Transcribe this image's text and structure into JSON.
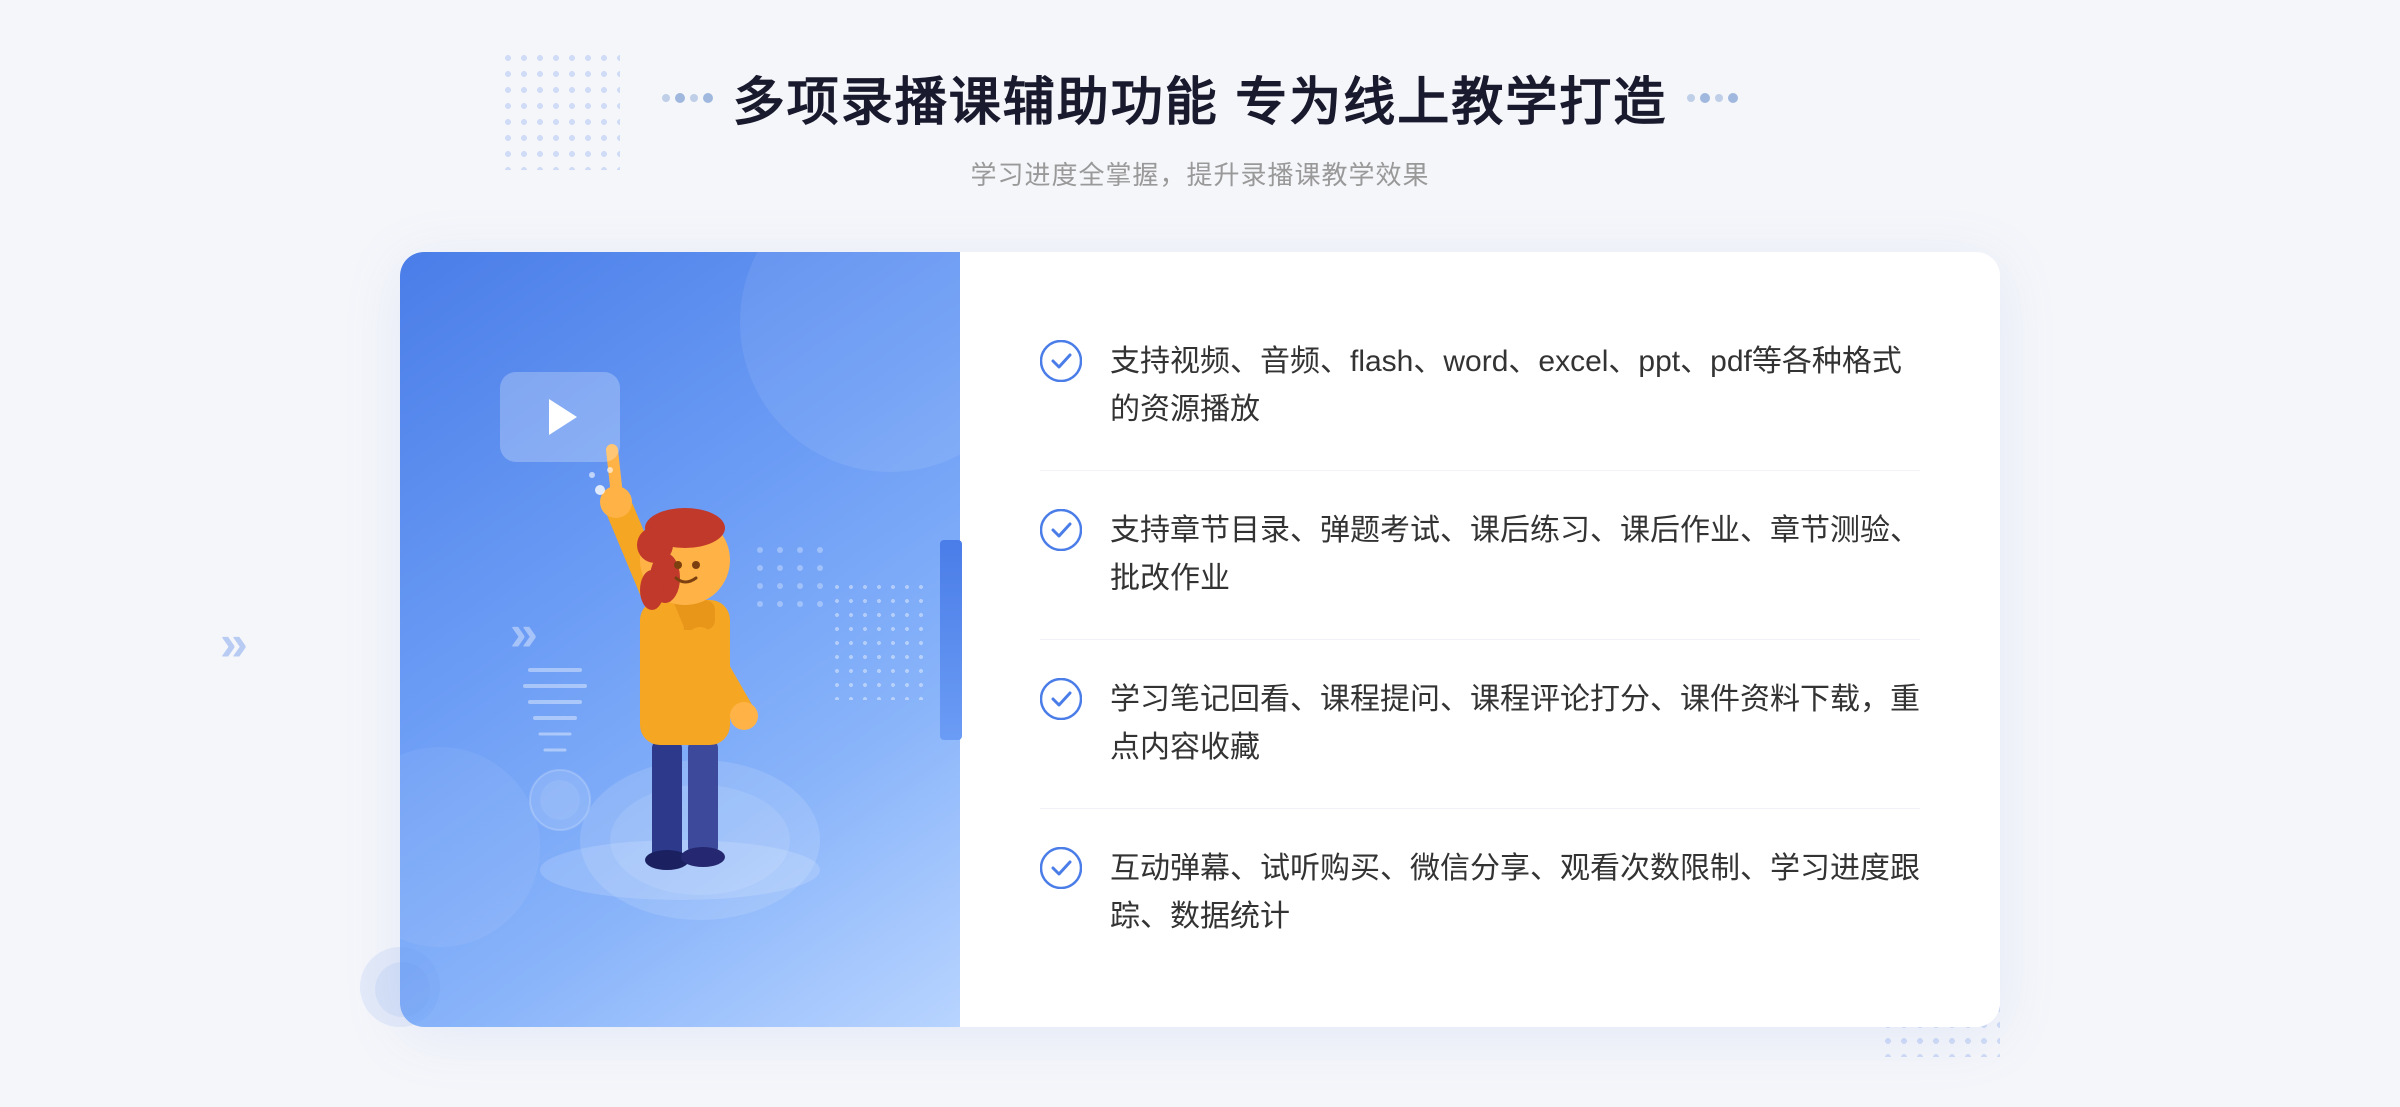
{
  "header": {
    "title": "多项录播课辅助功能 专为线上教学打造",
    "subtitle": "学习进度全掌握，提升录播课教学效果"
  },
  "features": [
    {
      "id": 1,
      "text": "支持视频、音频、flash、word、excel、ppt、pdf等各种格式的资源播放"
    },
    {
      "id": 2,
      "text": "支持章节目录、弹题考试、课后练习、课后作业、章节测验、批改作业"
    },
    {
      "id": 3,
      "text": "学习笔记回看、课程提问、课程评论打分、课件资料下载，重点内容收藏"
    },
    {
      "id": 4,
      "text": "互动弹幕、试听购买、微信分享、观看次数限制、学习进度跟踪、数据统计"
    }
  ],
  "icons": {
    "check_color": "#4a7de8",
    "title_dot_color": "#c0cfe8"
  }
}
